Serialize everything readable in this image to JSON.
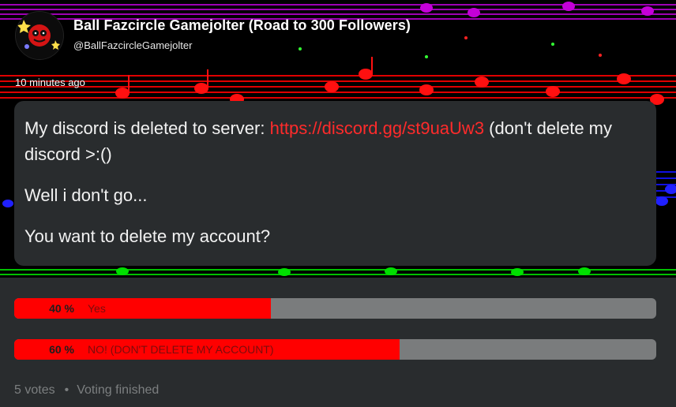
{
  "header": {
    "username": "Ball Fazcircle Gamejolter (Road to 300 Followers)",
    "handle": "@BallFazcircleGamejolter",
    "avatar_icon": "ball-character-avatar"
  },
  "post": {
    "timestamp": "10 minutes ago",
    "paragraphs": [
      {
        "before": "My discord is deleted to server: ",
        "link": "https://discord.gg/st9uaUw3",
        "after": " (don't delete my discord >:()"
      },
      {
        "text": "Well i don't go..."
      },
      {
        "text": "You want to delete my account?"
      }
    ]
  },
  "poll": {
    "options": [
      {
        "percent_label": "40 %",
        "label": "Yes",
        "percent": 40
      },
      {
        "percent_label": "60 %",
        "label": "NO! (DON'T DELETE MY ACCOUNT)",
        "percent": 60
      }
    ],
    "votes": "5 votes",
    "status": "Voting finished"
  },
  "colors": {
    "accent": "#ff0000",
    "card_bg": "#292c2e",
    "bar_bg": "#7a7c7d",
    "link": "#ff2b2b"
  }
}
